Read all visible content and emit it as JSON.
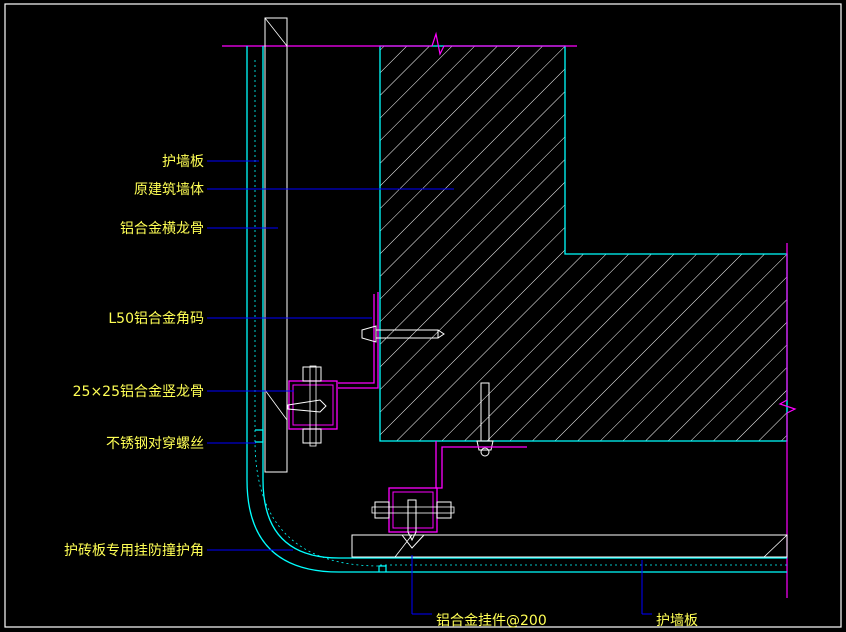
{
  "labels": {
    "hu_qiang_ban": "护墙板",
    "yuan_jian_zhu": "原建筑墙体",
    "lv_heng_chong": "铝合金横龙骨",
    "l50_jiao_ma": "L50铝合金角码",
    "shu_chong_gu": "25×25铝合金竖龙骨",
    "luo_si": "不锈钢对穿螺丝",
    "hu_jiao": "护砖板专用挂防撞护角",
    "gua_jian": "铝合金挂件@200",
    "hu_qiang_ban_2": "护墙板"
  },
  "colors": {
    "background": "#000000",
    "wall": "#00ffff",
    "metal": "#ff00ff",
    "leader": "#0000ff",
    "detail": "#ffffff",
    "label": "#ffff55",
    "frame": "#ffffff"
  }
}
